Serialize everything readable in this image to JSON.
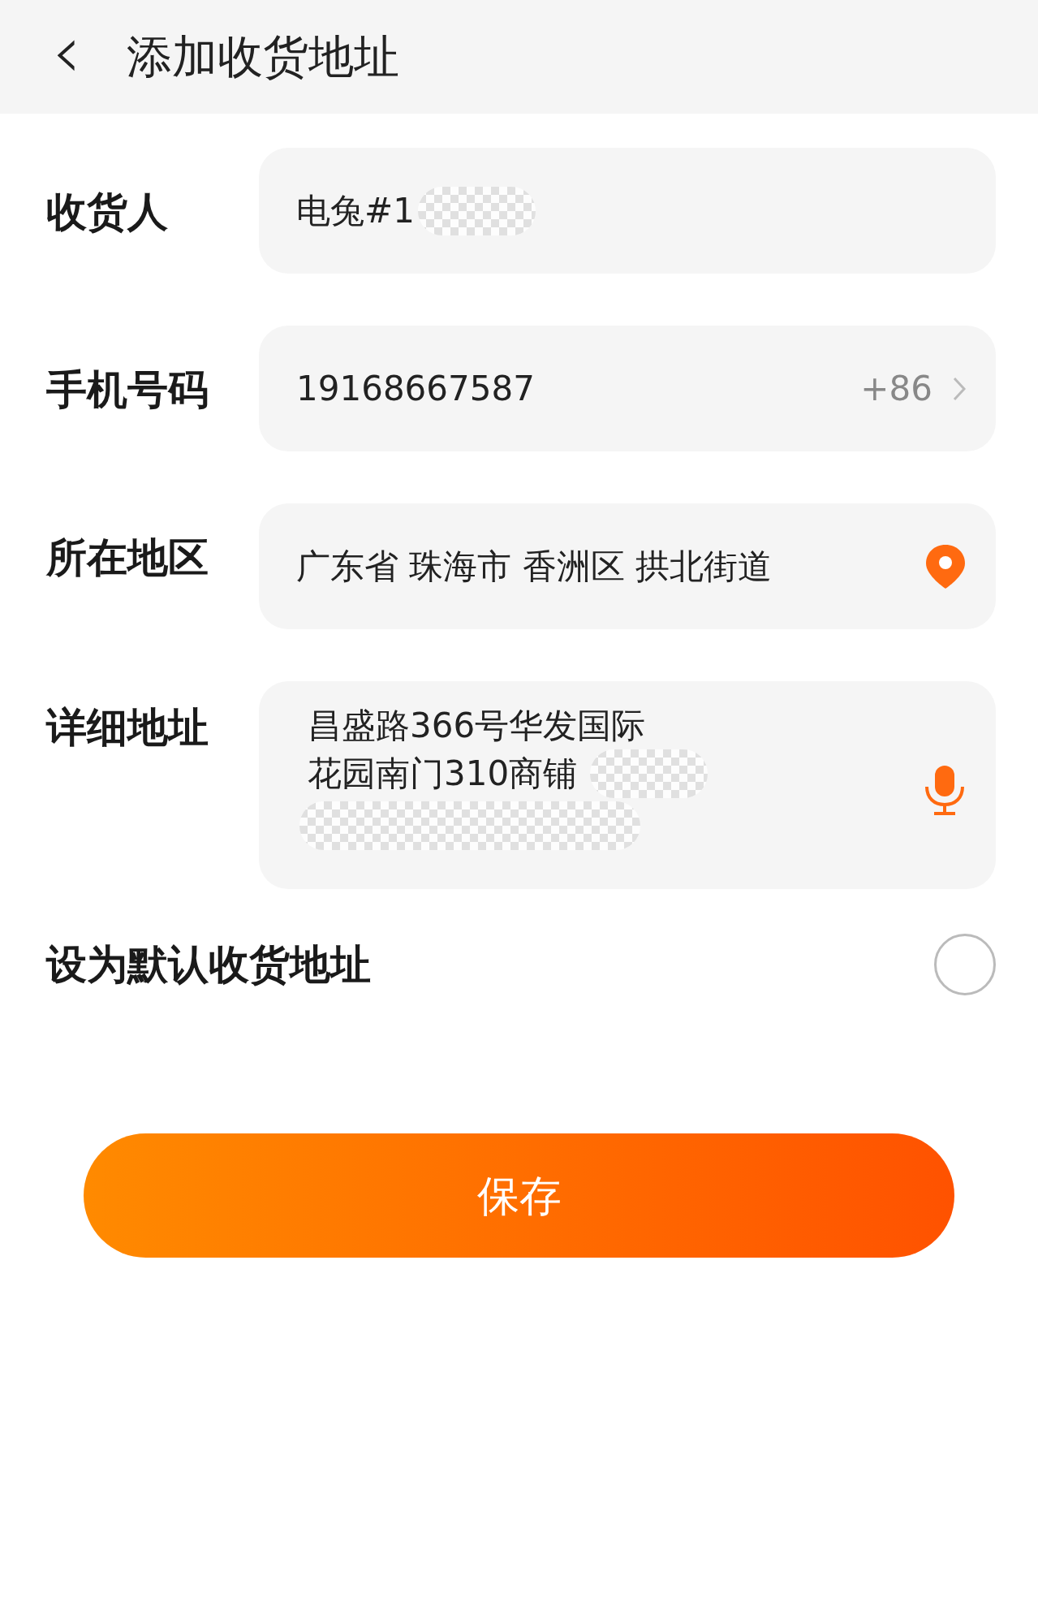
{
  "header": {
    "back_icon": "‹",
    "title": "添加收货地址"
  },
  "fields": [
    {
      "kind": "text",
      "label": "收货人",
      "value": "电兔#1",
      "redacted": true
    },
    {
      "kind": "phone",
      "label": "手机号码",
      "value": "19168667587",
      "country_code": "+86"
    },
    {
      "kind": "region",
      "label": "所在地区",
      "value": "广东省 珠海市 香洲区 拱北街道"
    },
    {
      "kind": "detail",
      "label": "详细地址",
      "lines": [
        "昌盛路366号华发国际",
        "花园南门310商铺"
      ],
      "redacted": true
    }
  ],
  "default_address": {
    "label": "设为默认收货地址",
    "checked": false
  },
  "save_button": {
    "label": "保存"
  }
}
